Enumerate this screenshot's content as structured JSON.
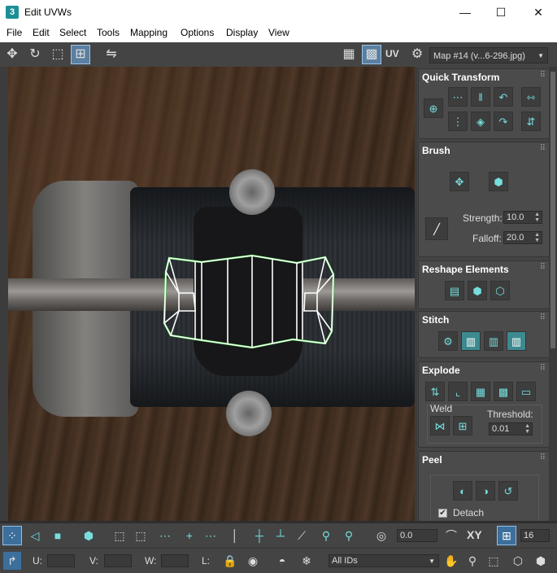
{
  "window": {
    "app_icon": "3",
    "title": "Edit UVWs",
    "minimize": "—",
    "maximize": "☐",
    "close": "✕"
  },
  "menu": [
    "File",
    "Edit",
    "Select",
    "Tools",
    "Mapping",
    "Options",
    "Display",
    "View"
  ],
  "toolbar": {
    "uv_label": "UV",
    "map_selector": "Map #14 (v...6-296.jpg)"
  },
  "panel": {
    "quick_transform": {
      "title": "Quick Transform"
    },
    "brush": {
      "title": "Brush",
      "strength_label": "Strength:",
      "strength_value": "10.0",
      "falloff_label": "Falloff:",
      "falloff_value": "20.0"
    },
    "reshape": {
      "title": "Reshape Elements"
    },
    "stitch": {
      "title": "Stitch"
    },
    "explode": {
      "title": "Explode",
      "weld_label": "Weld",
      "threshold_label": "Threshold:",
      "threshold_value": "0.01"
    },
    "peel": {
      "title": "Peel",
      "detach_label": "Detach",
      "detach_checked": "✔"
    }
  },
  "bottom": {
    "rotate_value": "0.0",
    "xy_label": "XY",
    "grid_value": "16",
    "u_label": "U:",
    "v_label": "V:",
    "w_label": "W:",
    "l_label": "L:",
    "u_value": "",
    "v_value": "",
    "w_value": "",
    "ids_select": "All IDs"
  },
  "colors": {
    "uv_edge": "#ffffff",
    "uv_border": "#33dd33",
    "accent": "#3c8a8f"
  }
}
